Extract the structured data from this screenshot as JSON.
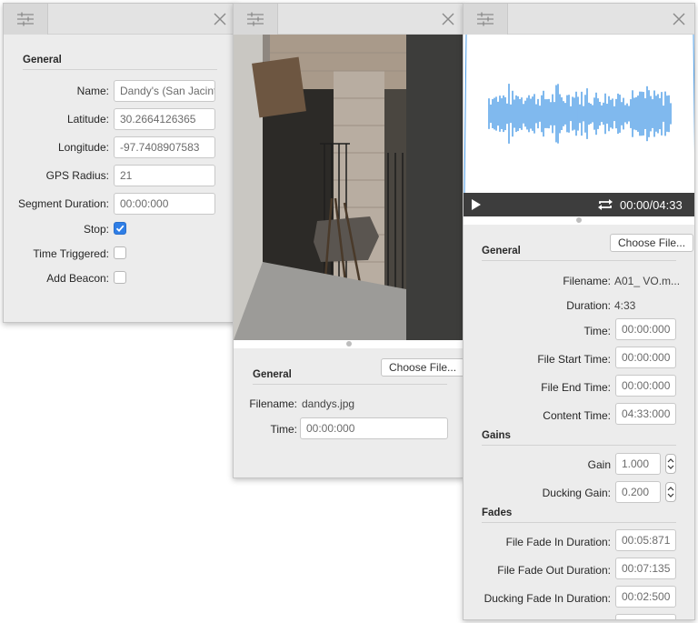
{
  "panel1": {
    "section": "General",
    "name_label": "Name:",
    "name_value": "Dandy's (San Jacinto)",
    "latitude_label": "Latitude:",
    "latitude_value": "30.2664126365",
    "longitude_label": "Longitude:",
    "longitude_value": "-97.7408907583",
    "gps_label": "GPS Radius:",
    "gps_value": "21",
    "segment_label": "Segment Duration:",
    "segment_value": "00:00:000",
    "stop_label": "Stop:",
    "stop_checked": true,
    "time_triggered_label": "Time Triggered:",
    "time_triggered_checked": false,
    "beacon_label": "Add Beacon:",
    "beacon_checked": false
  },
  "panel2": {
    "choose_file": "Choose File...",
    "section": "General",
    "filename_label": "Filename:",
    "filename_value": "dandys.jpg",
    "time_label": "Time:",
    "time_value": "00:00:000"
  },
  "panel3": {
    "player_time": "00:00/04:33",
    "choose_file": "Choose File...",
    "general_section": "General",
    "filename_label": "Filename:",
    "filename_value": "A01_ VO.m...",
    "duration_label": "Duration:",
    "duration_value": "4:33",
    "time_label": "Time:",
    "time_value": "00:00:000",
    "file_start_label": "File Start Time:",
    "file_start_value": "00:00:000",
    "file_end_label": "File End Time:",
    "file_end_value": "00:00:000",
    "content_time_label": "Content Time:",
    "content_time_value": "04:33:000",
    "gains_section": "Gains",
    "gain_label": "Gain",
    "gain_value": "1.000",
    "ducking_gain_label": "Ducking Gain:",
    "ducking_gain_value": "0.200",
    "fades_section": "Fades",
    "fade_in_label": "File Fade In Duration:",
    "fade_in_value": "00:05:871",
    "fade_out_label": "File Fade Out Duration:",
    "fade_out_value": "00:07:135",
    "ducking_fade_in_label": "Ducking Fade In Duration:",
    "ducking_fade_in_value": "00:02:500"
  },
  "colors": {
    "accent": "#2f7ee6",
    "waveform": "#4a9be6",
    "player_bar": "#3d3d3d"
  }
}
